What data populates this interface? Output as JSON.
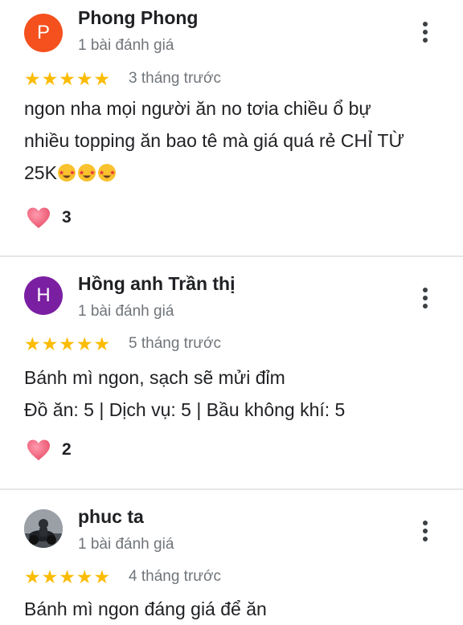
{
  "colors": {
    "star": "#fbbc04",
    "avatar_p": "#f4511e",
    "avatar_h": "#7b1fa2",
    "heart": "#e8506a"
  },
  "reviews": [
    {
      "avatar_letter": "P",
      "name": "Phong Phong",
      "review_count": "1 bài đánh giá",
      "stars": "★★★★★",
      "time": "3 tháng trước",
      "text_line1": "ngon nha mọi người ăn no tơia chiều ổ bự",
      "text_line2": "nhiều topping ăn bao tê mà giá quá rẻ CHỈ TỪ",
      "text_line3": "25K",
      "emoji_icons": [
        "star-struck-icon",
        "star-struck-icon",
        "star-struck-icon"
      ],
      "likes": "3"
    },
    {
      "avatar_letter": "H",
      "name": "Hồng anh Trần thị",
      "review_count": "1 bài đánh giá",
      "stars": "★★★★★",
      "time": "5 tháng trước",
      "text_line1": "Bánh mì ngon, sạch sẽ mửi đỉm",
      "text_line2": "Đồ ăn: 5 | Dịch vụ: 5 | Bầu không khí: 5",
      "likes": "2"
    },
    {
      "avatar_icon": "profile-photo",
      "name": "phuc ta",
      "review_count": "1 bài đánh giá",
      "stars": "★★★★★",
      "time": "4 tháng trước",
      "text_line1": "Bánh mì ngon đáng giá để ăn"
    }
  ]
}
